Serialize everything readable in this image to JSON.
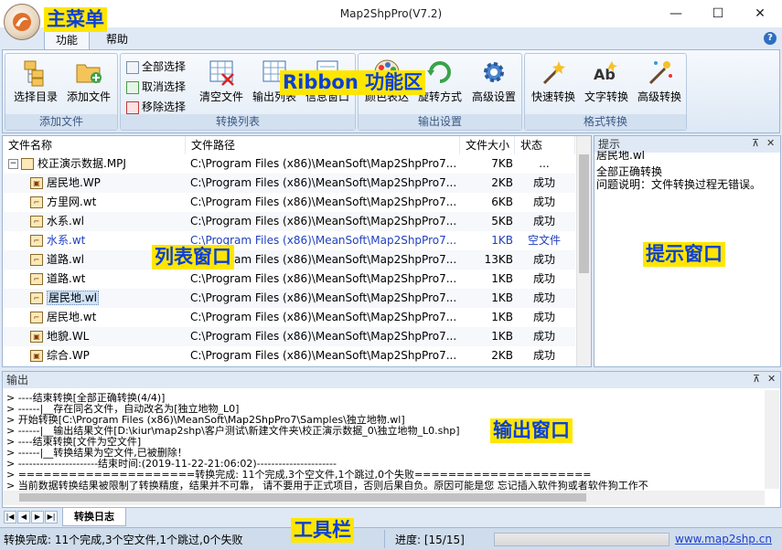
{
  "window": {
    "title": "Map2ShpPro(V7.2)",
    "min_symbol": "—",
    "max_symbol": "☐",
    "close_symbol": "✕"
  },
  "tabs": {
    "func": "功能",
    "help": "帮助",
    "help_icon": "?"
  },
  "ribbon": {
    "groups": [
      {
        "label": "添加文件"
      },
      {
        "label": "转换列表"
      },
      {
        "label": "输出设置"
      },
      {
        "label": "格式转换"
      }
    ],
    "select_dir": "选择目录",
    "add_file": "添加文件",
    "select_all": "全部选择",
    "deselect": "取消选择",
    "remove_sel": "移除选择",
    "clear_file": "清空文件",
    "output_list": "输出列表",
    "info_window": "信息窗口",
    "color_table": "颜色表达",
    "rotate_mode": "旋转方式",
    "advanced_settings": "高级设置",
    "fast_convert": "快速转换",
    "text_convert": "文字转换",
    "advanced_convert": "高级转换"
  },
  "list": {
    "headers": {
      "name": "文件名称",
      "path": "文件路径",
      "size": "文件大小",
      "status": "状态"
    },
    "rows": [
      {
        "expand": "−",
        "icon": "",
        "name": "校正演示数据.MPJ",
        "path": "C:\\Program Files (x86)\\MeanSoft\\Map2ShpPro7...",
        "size": "7KB",
        "status": "...",
        "color": "#000000"
      },
      {
        "icon": "▣",
        "name": "居民地.WP",
        "path": "C:\\Program Files (x86)\\MeanSoft\\Map2ShpPro7...",
        "size": "2KB",
        "status": "成功",
        "color": "#000000"
      },
      {
        "icon": "⌐",
        "name": "方里网.wt",
        "path": "C:\\Program Files (x86)\\MeanSoft\\Map2ShpPro7...",
        "size": "6KB",
        "status": "成功",
        "color": "#000000"
      },
      {
        "icon": "⌐",
        "name": "水系.wl",
        "path": "C:\\Program Files (x86)\\MeanSoft\\Map2ShpPro7...",
        "size": "5KB",
        "status": "成功",
        "color": "#000000"
      },
      {
        "icon": "⌐",
        "name": "水系.wt",
        "path": "C:\\Program Files (x86)\\MeanSoft\\Map2ShpPro7...",
        "size": "1KB",
        "status": "空文件",
        "color": "#1f3fbf"
      },
      {
        "icon": "⌐",
        "name": "道路.wl",
        "path": "C:\\Program Files (x86)\\MeanSoft\\Map2ShpPro7...",
        "size": "13KB",
        "status": "成功",
        "color": "#000000"
      },
      {
        "icon": "⌐",
        "name": "道路.wt",
        "path": "C:\\Program Files (x86)\\MeanSoft\\Map2ShpPro7...",
        "size": "1KB",
        "status": "成功",
        "color": "#000000"
      },
      {
        "icon": "⌐",
        "name": "居民地.wl",
        "path": "C:\\Program Files (x86)\\MeanSoft\\Map2ShpPro7...",
        "size": "1KB",
        "status": "成功",
        "color": "#000000",
        "selected": true
      },
      {
        "icon": "⌐",
        "name": "居民地.wt",
        "path": "C:\\Program Files (x86)\\MeanSoft\\Map2ShpPro7...",
        "size": "1KB",
        "status": "成功",
        "color": "#000000"
      },
      {
        "icon": "▣",
        "name": "地貌.WL",
        "path": "C:\\Program Files (x86)\\MeanSoft\\Map2ShpPro7...",
        "size": "1KB",
        "status": "成功",
        "color": "#000000"
      },
      {
        "icon": "▣",
        "name": "综合.WP",
        "path": "C:\\Program Files (x86)\\MeanSoft\\Map2ShpPro7...",
        "size": "2KB",
        "status": "成功",
        "color": "#000000"
      }
    ]
  },
  "hint": {
    "title": "提示",
    "pin": "⊼",
    "close": "✕",
    "lines": [
      "居民地.wl",
      "全部正确转换",
      "问题说明：文件转换过程无错误。"
    ]
  },
  "output": {
    "title": "输出",
    "lines": [
      "> ----结束转换[全部正确转换(4/4)]",
      "> ------|__存在同名文件，自动改名为[独立地物_L0]",
      "> 开始转换[C:\\Program Files (x86)\\MeanSoft\\Map2ShpPro7\\Samples\\独立地物.wl]",
      "> ------|__输出结果文件[D:\\kiur\\map2shp\\客户测试\\新建文件夹\\校正演示数据_0\\独立地物_L0.shp]",
      "> ----结束转换[文件为空文件]",
      "> ------|__转换结果为空文件,已被删除！",
      "> ----------------------结束时间:(2019-11-22-21:06:02)----------------------",
      "> =====================转换完成: 11个完成,3个空文件,1个跳过,0个失败=====================",
      ">  当前数据转换结果被限制了转换精度，结果并不可靠，  请不要用于正式项目，否则后果自负。原因可能是您 忘记插入软件狗或者软件狗工作不"
    ],
    "log_tab": "转换日志",
    "nav": [
      "|◀",
      "◀",
      "▶",
      "▶|"
    ]
  },
  "status": {
    "summary": "转换完成: 11个完成,3个空文件,1个跳过,0个失败",
    "progress_label": "进度: [15/15]",
    "progress": 1.0,
    "url": "www.map2shp.cn"
  },
  "annotations": {
    "main_menu": "主菜单",
    "ribbon": "Ribbon 功能区",
    "list_window": "列表窗口",
    "hint_window": "提示窗口",
    "output_window": "输出窗口",
    "toolbar": "工具栏"
  }
}
